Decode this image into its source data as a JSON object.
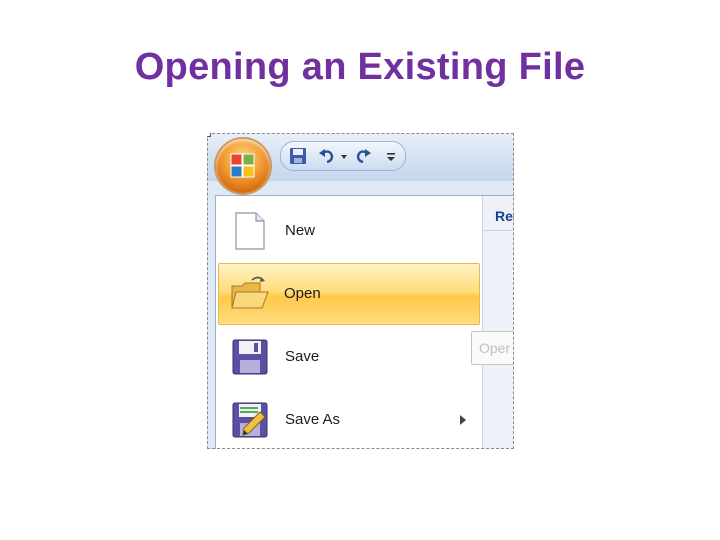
{
  "slide": {
    "title": "Opening an Existing File"
  },
  "quick_access_toolbar": {
    "buttons": [
      "save-icon",
      "undo-icon",
      "dropdown-arrow-icon",
      "redo-icon",
      "customize-icon"
    ]
  },
  "office_menu": {
    "items": [
      {
        "label": "New",
        "icon": "new-document-icon",
        "mnemonic": "N"
      },
      {
        "label": "Open",
        "icon": "open-folder-icon",
        "mnemonic": "O",
        "highlighted": true
      },
      {
        "label": "Save",
        "icon": "floppy-disk-icon",
        "mnemonic": "S"
      },
      {
        "label": "Save As",
        "icon": "save-as-icon",
        "mnemonic": "A",
        "has_submenu": true
      }
    ],
    "recent_header": "Rec",
    "tooltip": "Oper"
  },
  "colors": {
    "title": "#7030a0",
    "highlight": "#ffd966",
    "ribbon": "#d3e0f1"
  }
}
